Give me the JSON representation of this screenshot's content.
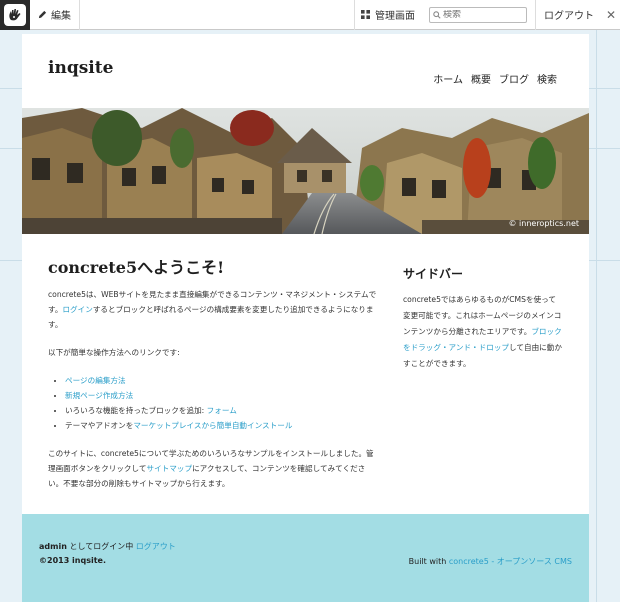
{
  "toolbar": {
    "edit_label": "編集",
    "dashboard_label": "管理画面",
    "search_placeholder": "検索",
    "logout_label": "ログアウト",
    "close_glyph": "✕"
  },
  "site": {
    "name": "inqsite",
    "nav": [
      "ホーム",
      "概要",
      "ブログ",
      "検索"
    ]
  },
  "hero": {
    "credit": "© inneroptics.net"
  },
  "main": {
    "title": "concrete5へようこそ!",
    "intro_1": "concrete5は、WEBサイトを見たまま直接編集ができるコンテンツ・マネジメント・システムです。",
    "intro_link": "ログイン",
    "intro_2": "するとブロックと呼ばれるページの構成要素を変更したり追加できるようになります。",
    "links_heading": "以下が簡単な操作方法へのリンクです:",
    "list": {
      "item1_link": "ページの編集方法",
      "item2_link": "新規ページ作成方法",
      "item3_text": "いろいろな機能を持ったブロックを追加: ",
      "item3_link": "フォーム",
      "item4_text": "テーマやアドオンを",
      "item4_link": "マーケットプレイスから簡単自動インストール"
    },
    "outro_1": "このサイトに、concrete5について学ぶためのいろいろなサンプルをインストールしました。管理画面ボタンをクリックして",
    "outro_link": "サイトマップ",
    "outro_2": "にアクセスして、コンテンツを確認してみてください。不要な部分の削除もサイトマップから行えます。"
  },
  "sidebar": {
    "title": "サイドバー",
    "text_1": "concrete5ではあらゆるものがCMSを使って変更可能です。これはホームページのメインコンテンツから分離されたエリアです。",
    "link": "ブロックをドラッグ・アンド・ドロップ",
    "text_2": "して自由に動かすことができます。"
  },
  "footer": {
    "user": "admin",
    "logged_in_text": " としてログイン中 ",
    "logout_link": "ログアウト",
    "copyright": "©2013 inqsite.",
    "built_with": "Built with ",
    "built_link": "concrete5 - オープンソース CMS"
  },
  "colors": {
    "link": "#2a9ec9",
    "footer_bg": "#a3dde4",
    "toolbar_bg": "#ffffff",
    "page_bg": "#e6f1f7"
  }
}
